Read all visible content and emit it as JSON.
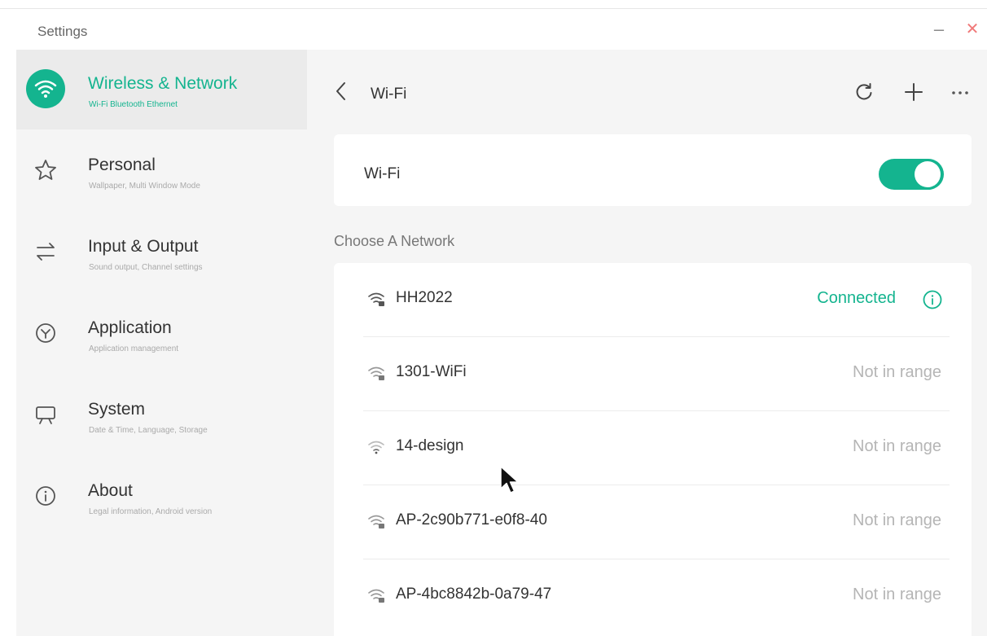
{
  "window": {
    "title": "Settings",
    "minimize_glyph": "–",
    "close_glyph": "✕"
  },
  "colors": {
    "accent": "#14b48f",
    "sidebar_bg": "#f5f5f5",
    "active_item_bg": "#ebebeb",
    "close": "#f07a7a"
  },
  "sidebar": {
    "items": [
      {
        "icon": "wifi-icon",
        "label": "Wireless & Network",
        "sub": "Wi-Fi Bluetooth Ethernet",
        "active": true
      },
      {
        "icon": "star-icon",
        "label": "Personal",
        "sub": "Wallpaper, Multi Window Mode",
        "active": false
      },
      {
        "icon": "swap-arrows-icon",
        "label": "Input & Output",
        "sub": "Sound output, Channel settings",
        "active": false
      },
      {
        "icon": "application-icon",
        "label": "Application",
        "sub": "Application management",
        "active": false
      },
      {
        "icon": "presentation-board-icon",
        "label": "System",
        "sub": "Date & Time, Language, Storage",
        "active": false
      },
      {
        "icon": "info-icon",
        "label": "About",
        "sub": "Legal information, Android version",
        "active": false
      }
    ]
  },
  "main": {
    "title": "Wi-Fi",
    "header_actions": [
      "refresh-icon",
      "plus-icon",
      "more-icon"
    ],
    "wifi_toggle": {
      "label": "Wi-Fi",
      "on": true
    },
    "section_label": "Choose A Network",
    "networks": [
      {
        "name": "HH2022",
        "status": "Connected",
        "connected": true
      },
      {
        "name": "1301-WiFi",
        "status": "Not in range",
        "connected": false
      },
      {
        "name": "14-design",
        "status": "Not in range",
        "connected": false
      },
      {
        "name": "AP-2c90b771-e0f8-40",
        "status": "Not in range",
        "connected": false
      },
      {
        "name": "AP-4bc8842b-0a79-47",
        "status": "Not in range",
        "connected": false
      }
    ]
  }
}
